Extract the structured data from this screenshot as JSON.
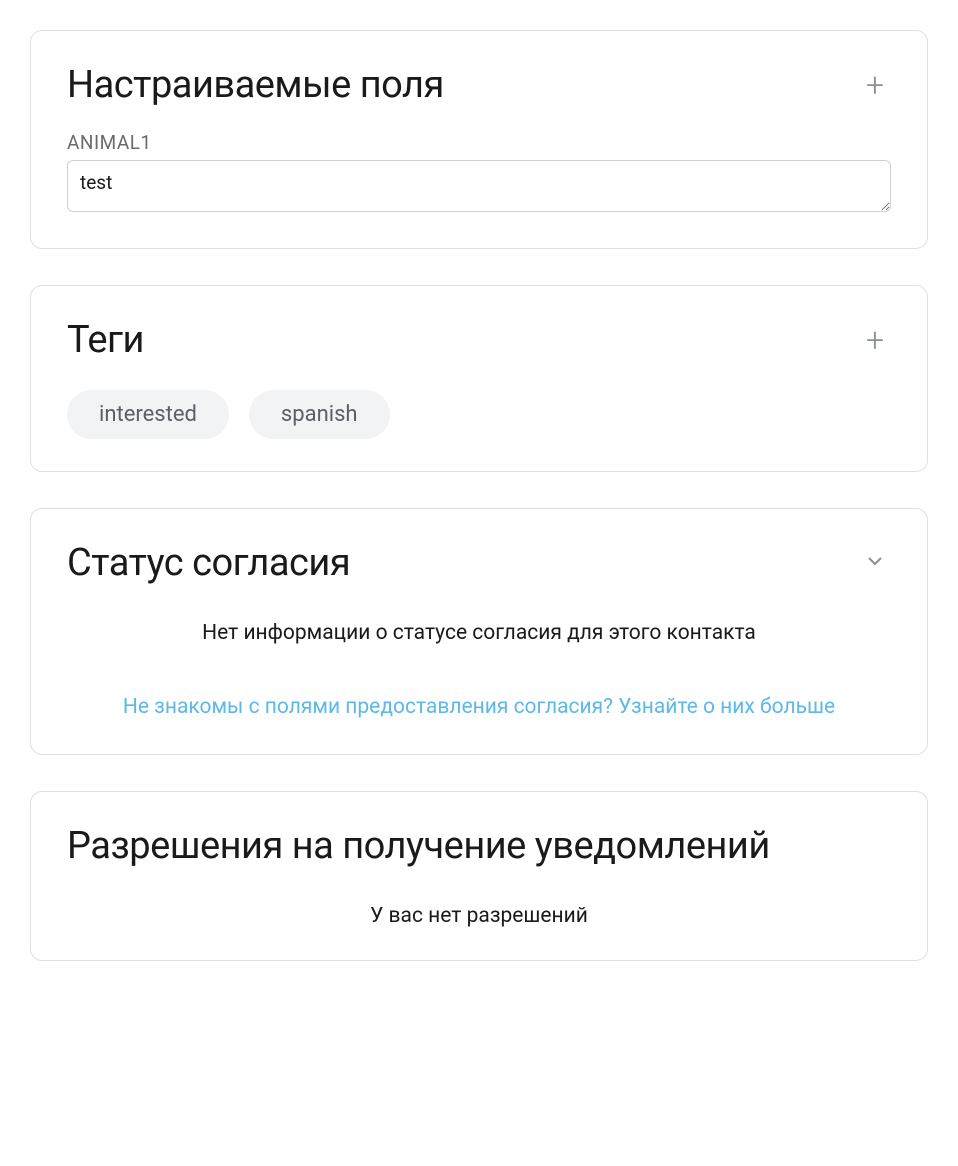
{
  "customFields": {
    "title": "Настраиваемые поля",
    "fields": [
      {
        "label": "ANIMAL1",
        "value": "test"
      }
    ]
  },
  "tags": {
    "title": "Теги",
    "items": [
      "interested",
      "spanish"
    ]
  },
  "consent": {
    "title": "Статус согласия",
    "emptyText": "Нет информации о статусе согласия для этого контакта",
    "helpLink": "Не знакомы с полями предоставления согласия? Узнайте о них больше"
  },
  "permissions": {
    "title": "Разрешения на получение уведомлений",
    "emptyText": "У вас нет разрешений"
  }
}
